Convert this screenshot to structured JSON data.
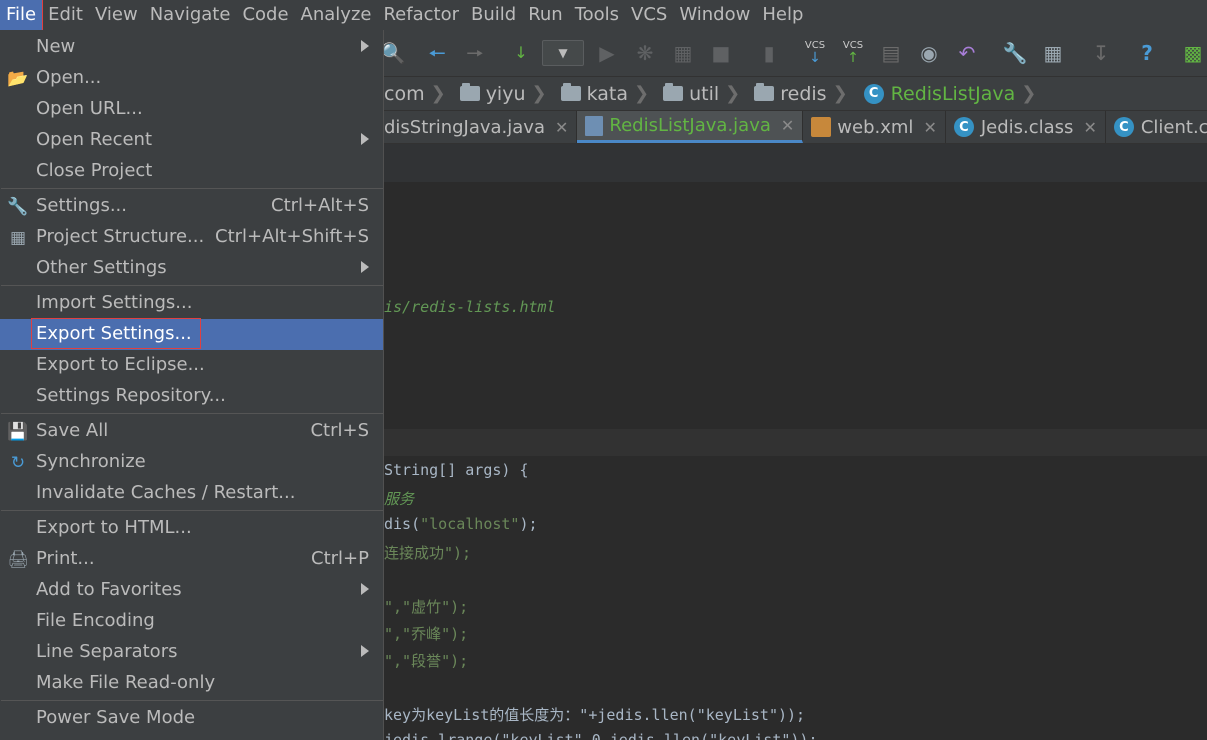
{
  "menubar": {
    "items": [
      "File",
      "Edit",
      "View",
      "Navigate",
      "Code",
      "Analyze",
      "Refactor",
      "Build",
      "Run",
      "Tools",
      "VCS",
      "Window",
      "Help"
    ]
  },
  "toolbar": {
    "vcs_label_1": "VCS",
    "vcs_label_2": "VCS",
    "help_label": "?"
  },
  "breadcrumb": {
    "items": [
      "com",
      "yiyu",
      "kata",
      "util",
      "redis"
    ],
    "class_name": "RedisListJava"
  },
  "tabs": [
    {
      "label": "disStringJava.java"
    },
    {
      "label": "RedisListJava.java"
    },
    {
      "label": "web.xml"
    },
    {
      "label": "Jedis.class"
    },
    {
      "label": "Client.class"
    }
  ],
  "file_menu": {
    "items": [
      {
        "label": "New"
      },
      {
        "label": "Open..."
      },
      {
        "label": "Open URL..."
      },
      {
        "label": "Open Recent"
      },
      {
        "label": "Close Project"
      },
      {
        "label": "Settings...",
        "shortcut": "Ctrl+Alt+S"
      },
      {
        "label": "Project Structure...",
        "shortcut": "Ctrl+Alt+Shift+S"
      },
      {
        "label": "Other Settings"
      },
      {
        "label": "Import Settings..."
      },
      {
        "label": "Export Settings..."
      },
      {
        "label": "Export to Eclipse..."
      },
      {
        "label": "Settings Repository..."
      },
      {
        "label": "Save All",
        "shortcut": "Ctrl+S"
      },
      {
        "label": "Synchronize"
      },
      {
        "label": "Invalidate Caches / Restart..."
      },
      {
        "label": "Export to HTML..."
      },
      {
        "label": "Print...",
        "shortcut": "Ctrl+P"
      },
      {
        "label": "Add to Favorites"
      },
      {
        "label": "File Encoding"
      },
      {
        "label": "Line Separators"
      },
      {
        "label": "Make File Read-only"
      },
      {
        "label": "Power Save Mode"
      }
    ]
  },
  "editor": {
    "lines": [
      {
        "text": "is/redis-lists.html"
      },
      {
        "text": "String[] args) {"
      },
      {
        "text": "服务"
      },
      {
        "text": "dis(",
        "str": "\"localhost\"",
        "tail": ");"
      },
      {
        "text": "连接成功\");"
      },
      {
        "text": "\",\"虚竹\");"
      },
      {
        "text": "\",\"乔峰\");"
      },
      {
        "text": "\",\"段誉\");"
      },
      {
        "text": "key为keyList的值长度为：\"+jedis.llen(\"keyList\"));"
      },
      {
        "text": "jedis.lrange(\"keyList\",0,jedis.llen(\"keyList\"));"
      }
    ]
  },
  "colors": {
    "accent": "#4b6eaf",
    "highlight_box": "#e04040",
    "active_tab_text": "#62b543"
  }
}
